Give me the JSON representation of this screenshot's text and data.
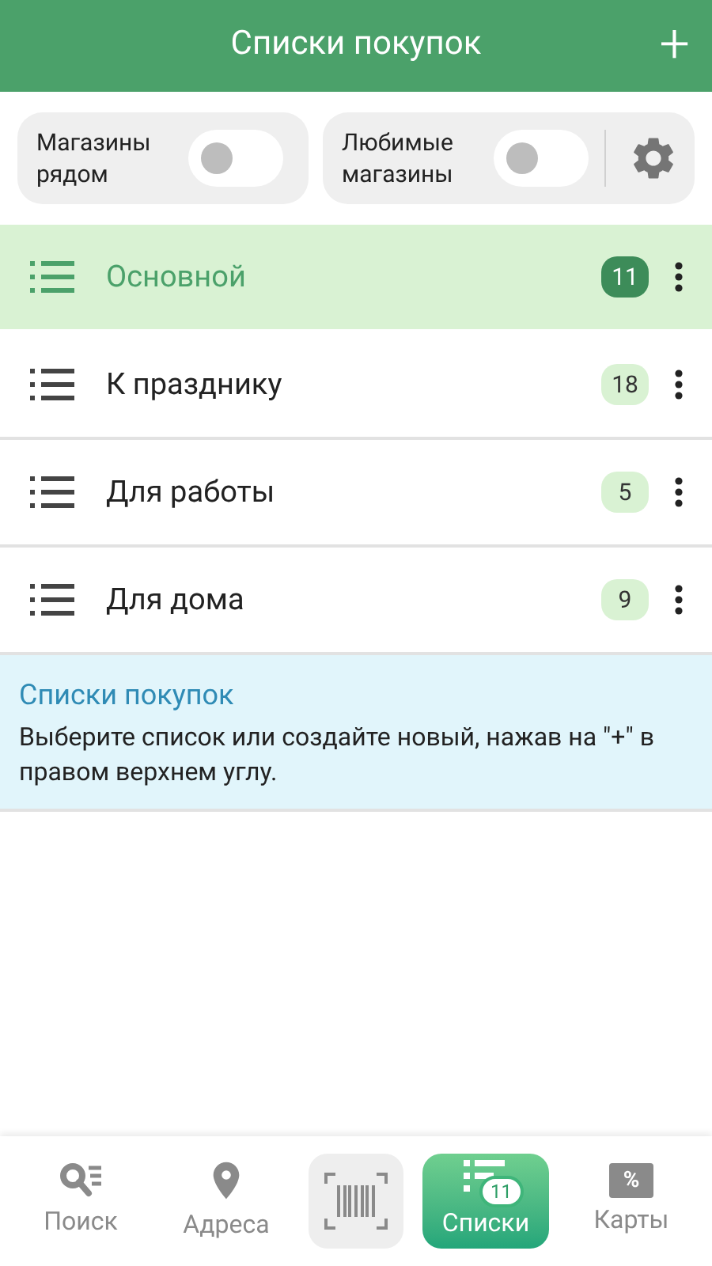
{
  "header": {
    "title": "Списки покупок",
    "add_label": "+"
  },
  "toggles": [
    {
      "label": "Магазины рядом",
      "on": false
    },
    {
      "label": "Любимые магазины",
      "on": false
    }
  ],
  "lists": [
    {
      "name": "Основной",
      "count": "11",
      "selected": true
    },
    {
      "name": "К празднику",
      "count": "18",
      "selected": false
    },
    {
      "name": "Для работы",
      "count": "5",
      "selected": false
    },
    {
      "name": "Для дома",
      "count": "9",
      "selected": false
    }
  ],
  "info": {
    "title": "Списки покупок",
    "text": "Выберите список или создайте новый, нажав на \"+\" в правом верхнем углу."
  },
  "nav": [
    {
      "kind": "search",
      "label": "Поиск",
      "selected": false
    },
    {
      "kind": "addresses",
      "label": "Адреса",
      "selected": false
    },
    {
      "kind": "scanner",
      "selected": false
    },
    {
      "kind": "lists",
      "label": "Списки",
      "badge": "11",
      "selected": true
    },
    {
      "kind": "cards",
      "label": "Карты",
      "icon_text": "%",
      "selected": false
    }
  ]
}
